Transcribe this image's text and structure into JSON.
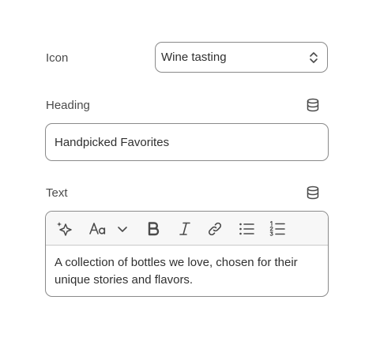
{
  "icon_field": {
    "label": "Icon",
    "value": "Wine tasting",
    "icons": {
      "chevron": "chevron-up-down-icon"
    }
  },
  "heading_field": {
    "label": "Heading",
    "value": "Handpicked Favorites",
    "icons": {
      "source": "database-icon"
    }
  },
  "text_field": {
    "label": "Text",
    "content": "A collection of bottles we love, chosen for their unique stories and flavors.",
    "icons": {
      "source": "database-icon"
    },
    "toolbar": [
      "magic-sparkle-icon",
      "font-size-icon",
      "chevron-down-icon",
      "bold-icon",
      "italic-icon",
      "link-icon",
      "bullet-list-icon",
      "numbered-list-icon"
    ]
  },
  "colors": {
    "border": "#8a8a8a",
    "text": "#303030",
    "label": "#4a4a4a",
    "toolbar_bg": "#f7f7f7"
  }
}
